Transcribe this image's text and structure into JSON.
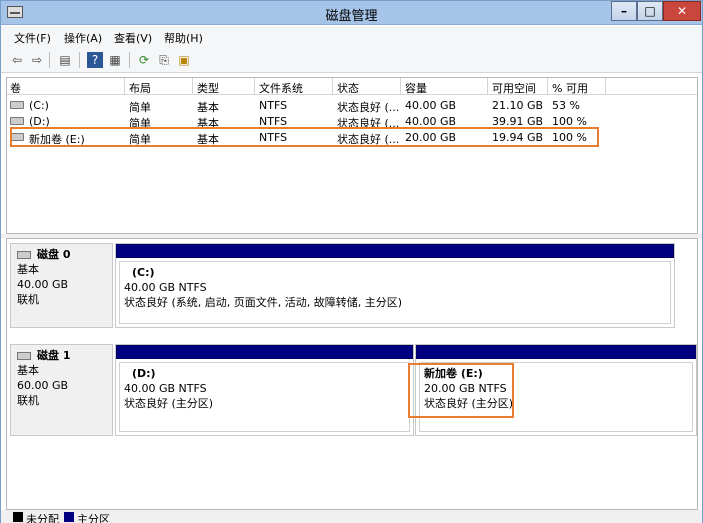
{
  "window": {
    "title": "磁盘管理"
  },
  "menu": [
    "文件(F)",
    "操作(A)",
    "查看(V)",
    "帮助(H)"
  ],
  "toolbar_icons": [
    "back-icon",
    "forward-icon",
    "console-tree-icon",
    "help-icon",
    "properties-icon",
    "refresh-icon",
    "export-icon",
    "wizard-icon"
  ],
  "list": {
    "columns": [
      "卷",
      "布局",
      "类型",
      "文件系统",
      "状态",
      "容量",
      "可用空间",
      "% 可用"
    ],
    "rows": [
      {
        "vol": "(C:)",
        "layout": "简单",
        "type": "基本",
        "fs": "NTFS",
        "status": "状态良好 (...",
        "cap": "40.00 GB",
        "free": "21.10 GB",
        "pct": "53 %"
      },
      {
        "vol": "(D:)",
        "layout": "简单",
        "type": "基本",
        "fs": "NTFS",
        "status": "状态良好 (...",
        "cap": "40.00 GB",
        "free": "39.91 GB",
        "pct": "100 %"
      },
      {
        "vol": "新加卷 (E:)",
        "layout": "简单",
        "type": "基本",
        "fs": "NTFS",
        "status": "状态良好 (...",
        "cap": "20.00 GB",
        "free": "19.94 GB",
        "pct": "100 %"
      }
    ]
  },
  "disks": [
    {
      "name": "磁盘 0",
      "type": "基本",
      "size": "40.00 GB",
      "state": "联机",
      "partitions": [
        {
          "name": "(C:)",
          "size": "40.00 GB NTFS",
          "status": "状态良好 (系统, 启动, 页面文件, 活动, 故障转储, 主分区)"
        }
      ]
    },
    {
      "name": "磁盘 1",
      "type": "基本",
      "size": "60.00 GB",
      "state": "联机",
      "partitions": [
        {
          "name": "(D:)",
          "size": "40.00 GB NTFS",
          "status": "状态良好 (主分区)"
        },
        {
          "name": "新加卷  (E:)",
          "size": "20.00 GB NTFS",
          "status": "状态良好 (主分区)"
        }
      ]
    }
  ],
  "legend": [
    {
      "label": "未分配",
      "color": "#000000"
    },
    {
      "label": "主分区",
      "color": "#000080"
    }
  ]
}
